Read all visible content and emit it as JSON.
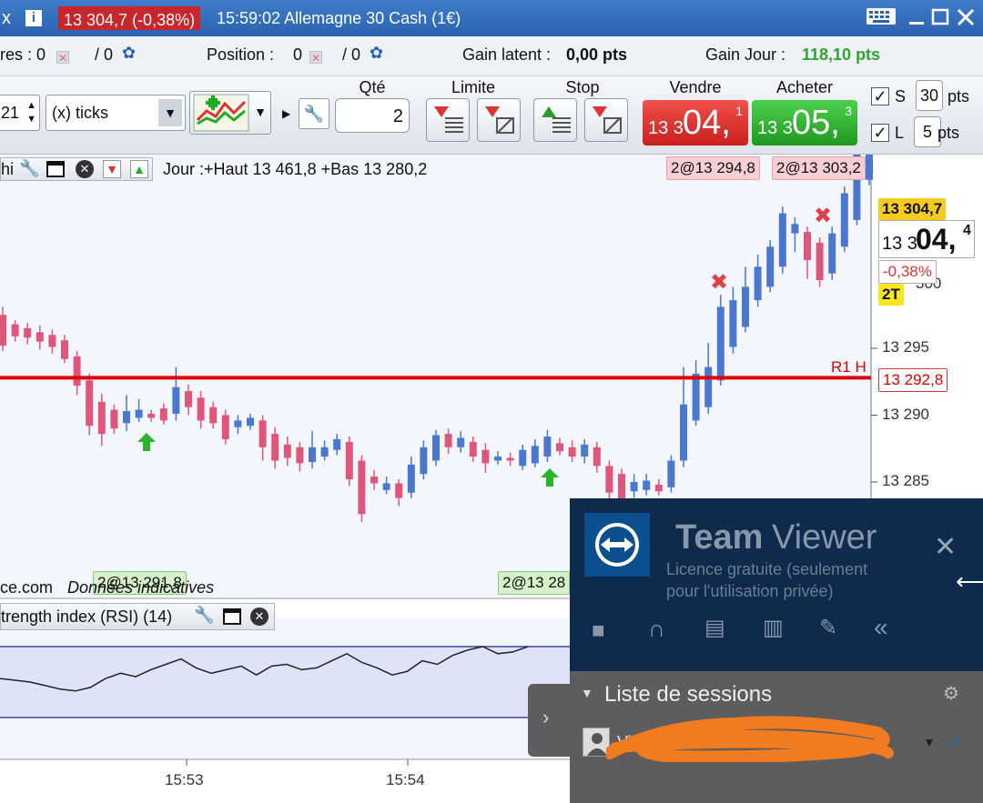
{
  "titlebar": {
    "left_fragment": "x",
    "info_icon": "i",
    "price_badge": "13 304,7 (-0,38%)",
    "title": "15:59:02 Allemagne 30 Cash (1€)"
  },
  "infobar": {
    "left_label": "res : 0",
    "left_slash": "/ 0",
    "position_label": "Position :",
    "position_value": "0",
    "position_slash": "/ 0",
    "gain_latent_label": "Gain latent :",
    "gain_latent_value": "0,00 pts",
    "gain_jour_label": "Gain Jour :",
    "gain_jour_value": "118,10 pts"
  },
  "toolbar": {
    "interval_value": "21",
    "unit_select": "(x) ticks",
    "qty_label": "Qté",
    "qty_value": "2",
    "limite_label": "Limite",
    "stop_label": "Stop",
    "vendre_label": "Vendre",
    "acheter_label": "Acheter",
    "sell_price_small": "13 3",
    "sell_price_big": "04,",
    "sell_price_sup": "1",
    "buy_price_small": "13 3",
    "buy_price_big": "05,",
    "buy_price_sup": "3",
    "s_label": "S",
    "s_value": "30",
    "l_label": "L",
    "l_value": "5",
    "pts_label": "pts"
  },
  "chart": {
    "header_left": "hi",
    "header_text": "Jour :+Haut 13 461,8 +Bas 13 280,2",
    "order_tag_1": "2@13 294,8",
    "order_tag_2": "2@13 303,2",
    "price_tag_current": "13 304,7",
    "price_tag_big_small": "13 3",
    "price_tag_big": "04,",
    "price_tag_big_sup": "4",
    "pct_tag": "-0,38%",
    "behind_pct": "300",
    "lots_tag": "2T",
    "r1_label": "R1 H",
    "r1_value": "13 292,8",
    "y_ticks": [
      "13 295",
      "13 290",
      "13 285"
    ],
    "bottom_tag_1": "2@13 291,8",
    "bottom_tag_2": "2@13 28",
    "footer_left": "ce.com",
    "footer_note": "Données indicatives",
    "rsi_header": "trength index (RSI) (14)",
    "x_ticks": [
      "15:53",
      "15:54"
    ],
    "colors": {
      "up": "#4a78d0",
      "down": "#e0567a",
      "r1": "#e00000",
      "rsi_band": "#dfe3f6"
    }
  },
  "chart_data": {
    "type": "candlestick",
    "y_ticks": [
      13295,
      13290,
      13285
    ],
    "x_ticks": [
      "15:53",
      "15:54"
    ],
    "resistance": {
      "label": "R1 H",
      "value": 13292.8
    },
    "candles": [
      {
        "o": 13297.5,
        "c": 13295.2,
        "h": 13298.1,
        "l": 13294.8
      },
      {
        "o": 13296.8,
        "c": 13295.9,
        "h": 13297.1,
        "l": 13295.5
      },
      {
        "o": 13296.5,
        "c": 13295.8,
        "h": 13296.9,
        "l": 13295.3
      },
      {
        "o": 13296.2,
        "c": 13295.5,
        "h": 13296.7,
        "l": 13294.9
      },
      {
        "o": 13296.0,
        "c": 13295.1,
        "h": 13296.4,
        "l": 13294.6
      },
      {
        "o": 13295.6,
        "c": 13294.2,
        "h": 13296.0,
        "l": 13293.9
      },
      {
        "o": 13294.4,
        "c": 13292.2,
        "h": 13294.8,
        "l": 13291.5
      },
      {
        "o": 13292.6,
        "c": 13289.2,
        "h": 13293.1,
        "l": 13288.5
      },
      {
        "o": 13291.0,
        "c": 13288.6,
        "h": 13291.6,
        "l": 13287.7
      },
      {
        "o": 13290.4,
        "c": 13289.0,
        "h": 13290.8,
        "l": 13288.6
      },
      {
        "o": 13289.4,
        "c": 13290.3,
        "h": 13291.5,
        "l": 13288.8
      },
      {
        "o": 13289.8,
        "c": 13290.4,
        "h": 13291.2,
        "l": 13289.5
      },
      {
        "o": 13290.1,
        "c": 13289.8,
        "h": 13290.4,
        "l": 13289.5
      },
      {
        "o": 13290.5,
        "c": 13289.6,
        "h": 13290.9,
        "l": 13289.3
      },
      {
        "o": 13290.1,
        "c": 13292.1,
        "h": 13293.6,
        "l": 13289.6
      },
      {
        "o": 13291.8,
        "c": 13290.6,
        "h": 13292.3,
        "l": 13290.0
      },
      {
        "o": 13291.3,
        "c": 13289.6,
        "h": 13291.8,
        "l": 13289.0
      },
      {
        "o": 13290.6,
        "c": 13289.4,
        "h": 13291.0,
        "l": 13289.0
      },
      {
        "o": 13290.0,
        "c": 13288.2,
        "h": 13290.4,
        "l": 13287.8
      },
      {
        "o": 13289.1,
        "c": 13289.6,
        "h": 13290.0,
        "l": 13288.6
      },
      {
        "o": 13289.2,
        "c": 13289.8,
        "h": 13290.1,
        "l": 13288.9
      },
      {
        "o": 13289.6,
        "c": 13287.6,
        "h": 13290.0,
        "l": 13286.6
      },
      {
        "o": 13288.6,
        "c": 13286.6,
        "h": 13289.1,
        "l": 13286.0
      },
      {
        "o": 13287.8,
        "c": 13286.8,
        "h": 13288.4,
        "l": 13286.2
      },
      {
        "o": 13287.6,
        "c": 13286.4,
        "h": 13288.0,
        "l": 13285.8
      },
      {
        "o": 13286.5,
        "c": 13287.6,
        "h": 13288.8,
        "l": 13286.0
      },
      {
        "o": 13286.9,
        "c": 13287.6,
        "h": 13288.1,
        "l": 13286.6
      },
      {
        "o": 13287.4,
        "c": 13288.2,
        "h": 13288.6,
        "l": 13287.0
      },
      {
        "o": 13288.0,
        "c": 13285.2,
        "h": 13288.4,
        "l": 13284.7
      },
      {
        "o": 13286.6,
        "c": 13282.6,
        "h": 13287.0,
        "l": 13282.0
      },
      {
        "o": 13285.4,
        "c": 13284.9,
        "h": 13285.9,
        "l": 13284.4
      },
      {
        "o": 13284.4,
        "c": 13284.9,
        "h": 13285.4,
        "l": 13284.1
      },
      {
        "o": 13284.9,
        "c": 13283.8,
        "h": 13285.2,
        "l": 13283.2
      },
      {
        "o": 13284.2,
        "c": 13286.3,
        "h": 13286.9,
        "l": 13283.8
      },
      {
        "o": 13285.6,
        "c": 13287.6,
        "h": 13288.1,
        "l": 13285.2
      },
      {
        "o": 13286.6,
        "c": 13288.5,
        "h": 13288.9,
        "l": 13286.2
      },
      {
        "o": 13288.6,
        "c": 13287.6,
        "h": 13289.0,
        "l": 13287.1
      },
      {
        "o": 13287.6,
        "c": 13288.3,
        "h": 13288.8,
        "l": 13287.2
      },
      {
        "o": 13288.0,
        "c": 13286.9,
        "h": 13288.4,
        "l": 13286.5
      },
      {
        "o": 13287.4,
        "c": 13286.4,
        "h": 13287.9,
        "l": 13285.7
      },
      {
        "o": 13286.6,
        "c": 13286.9,
        "h": 13287.3,
        "l": 13286.3
      },
      {
        "o": 13286.8,
        "c": 13286.6,
        "h": 13287.2,
        "l": 13286.2
      },
      {
        "o": 13286.2,
        "c": 13287.4,
        "h": 13287.8,
        "l": 13285.9
      },
      {
        "o": 13286.4,
        "c": 13287.7,
        "h": 13288.2,
        "l": 13286.1
      },
      {
        "o": 13286.9,
        "c": 13288.4,
        "h": 13288.9,
        "l": 13286.5
      },
      {
        "o": 13287.9,
        "c": 13287.3,
        "h": 13288.3,
        "l": 13287.0
      },
      {
        "o": 13287.6,
        "c": 13286.9,
        "h": 13288.1,
        "l": 13286.5
      },
      {
        "o": 13286.9,
        "c": 13287.8,
        "h": 13288.2,
        "l": 13286.4
      },
      {
        "o": 13287.6,
        "c": 13286.2,
        "h": 13288.0,
        "l": 13285.7
      },
      {
        "o": 13286.2,
        "c": 13284.2,
        "h": 13286.6,
        "l": 13283.6
      },
      {
        "o": 13285.6,
        "c": 13283.6,
        "h": 13286.0,
        "l": 13283.2
      },
      {
        "o": 13284.3,
        "c": 13285.0,
        "h": 13285.6,
        "l": 13283.8
      },
      {
        "o": 13284.4,
        "c": 13285.1,
        "h": 13285.6,
        "l": 13284.0
      },
      {
        "o": 13284.8,
        "c": 13284.3,
        "h": 13285.2,
        "l": 13284.0
      },
      {
        "o": 13284.6,
        "c": 13286.6,
        "h": 13287.0,
        "l": 13284.2
      },
      {
        "o": 13286.6,
        "c": 13290.8,
        "h": 13293.6,
        "l": 13286.1
      },
      {
        "o": 13289.6,
        "c": 13293.1,
        "h": 13294.1,
        "l": 13289.2
      },
      {
        "o": 13290.6,
        "c": 13293.6,
        "h": 13295.4,
        "l": 13290.1
      },
      {
        "o": 13292.6,
        "c": 13298.1,
        "h": 13299.0,
        "l": 13292.2
      },
      {
        "o": 13295.1,
        "c": 13298.6,
        "h": 13299.6,
        "l": 13294.6
      },
      {
        "o": 13296.6,
        "c": 13299.6,
        "h": 13301.1,
        "l": 13296.2
      },
      {
        "o": 13298.6,
        "c": 13301.1,
        "h": 13302.0,
        "l": 13298.1
      },
      {
        "o": 13299.6,
        "c": 13302.6,
        "h": 13303.1,
        "l": 13299.2
      },
      {
        "o": 13301.1,
        "c": 13305.1,
        "h": 13305.6,
        "l": 13300.6
      },
      {
        "o": 13303.6,
        "c": 13304.3,
        "h": 13304.8,
        "l": 13302.2
      },
      {
        "o": 13303.7,
        "c": 13301.6,
        "h": 13304.1,
        "l": 13300.2
      },
      {
        "o": 13302.9,
        "c": 13300.1,
        "h": 13303.3,
        "l": 13299.6
      },
      {
        "o": 13300.6,
        "c": 13303.6,
        "h": 13304.1,
        "l": 13300.1
      },
      {
        "o": 13302.6,
        "c": 13306.6,
        "h": 13307.1,
        "l": 13302.2
      },
      {
        "o": 13304.6,
        "c": 13309.6,
        "h": 13310.1,
        "l": 13304.2
      },
      {
        "o": 13307.6,
        "c": 13310.6,
        "h": 13311.1,
        "l": 13307.2
      }
    ],
    "rsi_series": [
      52,
      51,
      50,
      48,
      46,
      45,
      47,
      52,
      55,
      53,
      57,
      60,
      63,
      58,
      55,
      57,
      59,
      54,
      59,
      60,
      57,
      58,
      62,
      66,
      61,
      58,
      54,
      56,
      62,
      60,
      65,
      68,
      70,
      66,
      67,
      70
    ]
  },
  "teamviewer": {
    "brand_bold": "Team",
    "brand_light": "Viewer",
    "license_line1": "Licence gratuite (seulement",
    "license_line2": "pour l'utilisation privée)",
    "sessions_label": "Liste de sessions",
    "session_prefix": "Vi"
  }
}
